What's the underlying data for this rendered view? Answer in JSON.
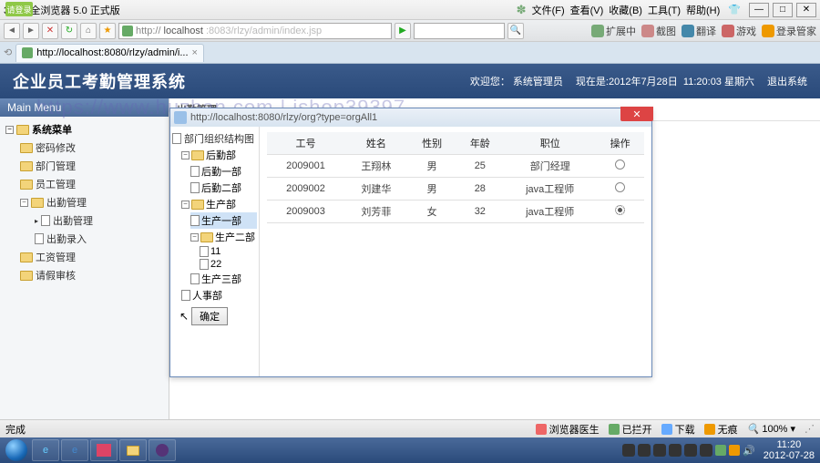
{
  "browser": {
    "title": "360安全浏览器 5.0 正式版",
    "menus": [
      "文件(F)",
      "查看(V)",
      "收藏(B)",
      "工具(T)",
      "帮助(H)"
    ],
    "bubble": "请登录",
    "address": {
      "proto": "http://",
      "host": "localhost",
      "rest": ":8083/rlzy/admin/index.jsp"
    },
    "tools": [
      "扩展中",
      "截图",
      "翻译",
      "游戏",
      "登录管家"
    ],
    "tab": {
      "label": "http://localhost:8080/rlzy/admin/i..."
    }
  },
  "app": {
    "title": "企业员工考勤管理系统",
    "welcome_label": "欢迎您：",
    "welcome_user": "系统管理员",
    "now_label": "现在是:",
    "now_date": "2012年7月28日",
    "now_time": "11:20:03",
    "now_week": "星期六",
    "logout": "退出系统"
  },
  "watermark": "https://www.huzhan.com | ishop39397",
  "sidebar": {
    "title": "Main Menu",
    "root": "系统菜单",
    "items": [
      "密码修改",
      "部门管理",
      "员工管理",
      "出勤管理",
      "工资管理",
      "请假审核"
    ],
    "sub_attend": [
      "出勤管理",
      "出勤录入"
    ]
  },
  "crumb": "出勤管理",
  "dialog": {
    "url": "http://localhost:8080/rlzy/org?type=orgAll1",
    "tree_title": "部门组织结构图",
    "tree": {
      "root": "后勤部",
      "l1": [
        "后勤一部",
        "后勤二部"
      ],
      "prod": "生产部",
      "prod_sub": [
        "生产一部",
        "生产二部"
      ],
      "twos": [
        "11",
        "22"
      ],
      "prod3": "生产三部",
      "hr": "人事部"
    },
    "confirm": "确定",
    "columns": [
      "工号",
      "姓名",
      "性别",
      "年龄",
      "职位",
      "操作"
    ],
    "rows": [
      {
        "id": "2009001",
        "name": "王翔林",
        "sex": "男",
        "age": "25",
        "role": "部门经理",
        "sel": false
      },
      {
        "id": "2009002",
        "name": "刘建华",
        "sex": "男",
        "age": "28",
        "role": "java工程师",
        "sel": false
      },
      {
        "id": "2009003",
        "name": "刘芳菲",
        "sex": "女",
        "age": "32",
        "role": "java工程师",
        "sel": true
      }
    ]
  },
  "status": {
    "done": "完成",
    "items": [
      "浏览器医生",
      "已拦开",
      "下载",
      "无痕",
      "100%"
    ]
  },
  "tray": {
    "time": "11:20",
    "date": "2012-07-28"
  }
}
